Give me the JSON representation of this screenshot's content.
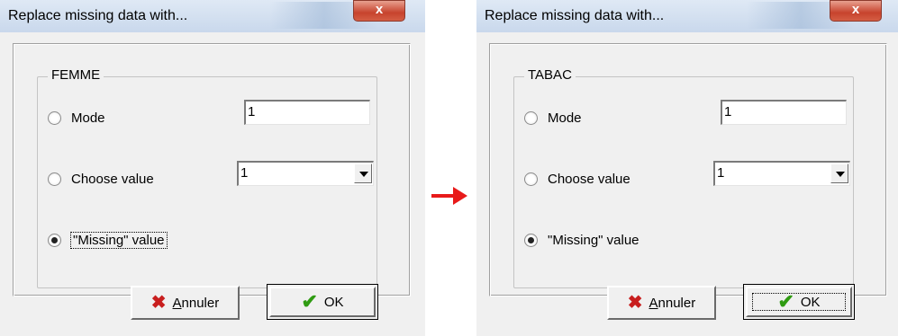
{
  "dialogs": [
    {
      "title": "Replace missing data with...",
      "close_label": "x",
      "group_label": "FEMME",
      "options": [
        {
          "label": "Mode",
          "selected": false
        },
        {
          "label": "Choose value",
          "selected": false
        },
        {
          "label": "\"Missing\" value",
          "selected": true
        }
      ],
      "mode_value": "1",
      "choose_value": "1",
      "cancel_label": "Annuler",
      "cancel_mnemonic": "A",
      "cancel_rest": "nnuler",
      "ok_label": "OK",
      "ok_focused": false
    },
    {
      "title": "Replace missing data with...",
      "close_label": "x",
      "group_label": "TABAC",
      "options": [
        {
          "label": "Mode",
          "selected": false
        },
        {
          "label": "Choose value",
          "selected": false
        },
        {
          "label": "\"Missing\" value",
          "selected": true
        }
      ],
      "mode_value": "1",
      "choose_value": "1",
      "cancel_label": "Annuler",
      "cancel_mnemonic": "A",
      "cancel_rest": "nnuler",
      "ok_label": "OK",
      "ok_focused": true
    }
  ],
  "colors": {
    "transition_arrow": "#e81a1a",
    "cancel_icon": "#c81e1e",
    "ok_icon": "#2f9b12"
  },
  "icons": {
    "cancel": "x-cross-icon",
    "ok": "check-icon",
    "transition": "right-arrow-icon"
  }
}
